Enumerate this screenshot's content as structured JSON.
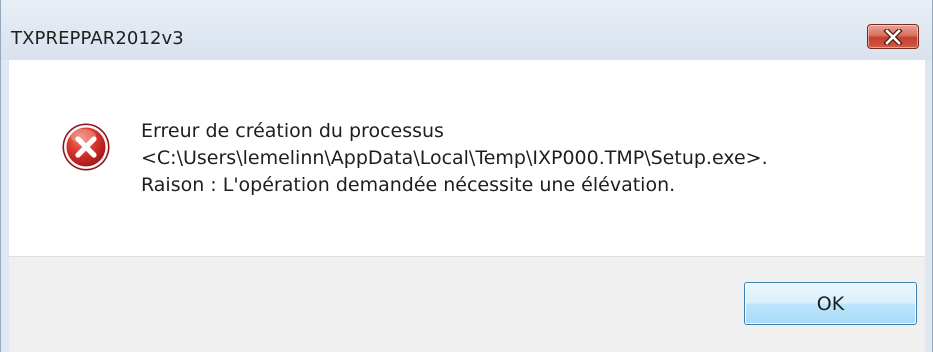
{
  "window": {
    "title": "TXPREPPAR2012v3"
  },
  "dialog": {
    "icon": "error-icon",
    "message_lines": [
      "Erreur de création du processus",
      "<C:\\Users\\lemelinn\\AppData\\Local\\Temp\\IXP000.TMP\\Setup.exe>.",
      "Raison : L'opération demandée nécessite une élévation."
    ],
    "ok_label": "OK"
  },
  "colors": {
    "close_button": "#c9503b",
    "error_icon": "#c8161d",
    "ok_button_border": "#3c7fb1"
  }
}
